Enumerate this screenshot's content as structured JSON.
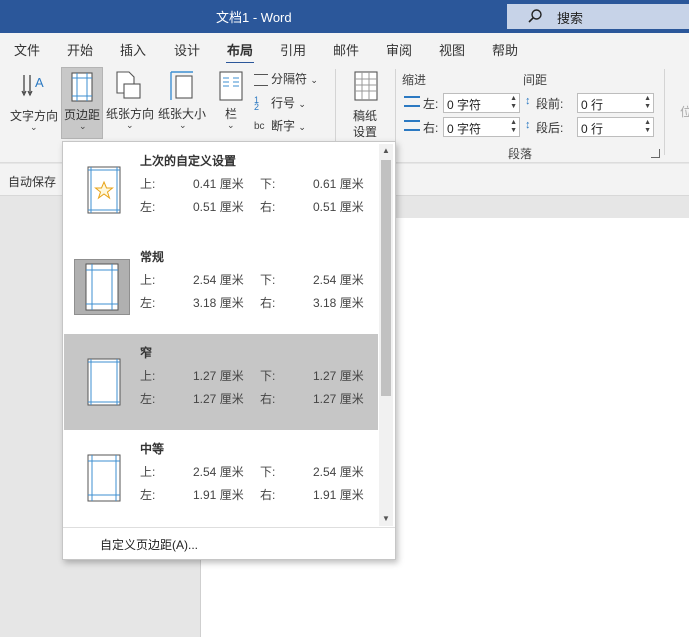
{
  "titlebar": {
    "title": "文档1  -  Word",
    "search_label": "搜索"
  },
  "tabs": [
    {
      "label": "文件"
    },
    {
      "label": "开始"
    },
    {
      "label": "插入"
    },
    {
      "label": "设计"
    },
    {
      "label": "布局"
    },
    {
      "label": "引用"
    },
    {
      "label": "邮件"
    },
    {
      "label": "审阅"
    },
    {
      "label": "视图"
    },
    {
      "label": "帮助"
    }
  ],
  "ribbon": {
    "text_direction": "文字方向",
    "margins": "页边距",
    "orientation": "纸张方向",
    "size": "纸张大小",
    "columns": "栏",
    "breaks": "分隔符",
    "line_numbers": "行号",
    "hyphenation": "断字",
    "manuscript_line1": "稿纸",
    "manuscript_line2": "设置",
    "indent_title": "缩进",
    "spacing_title": "间距",
    "indent_left_label": "左:",
    "indent_left_value": "0 字符",
    "indent_right_label": "右:",
    "indent_right_value": "0 字符",
    "space_before_label": "段前:",
    "space_before_value": "0 行",
    "space_after_label": "段后:",
    "space_after_value": "0 行",
    "paragraph_group": "段落",
    "position_partial": "位"
  },
  "quickbar": {
    "autosave": "自动保存"
  },
  "margins_menu": {
    "items": [
      {
        "name": "上次的自定义设置",
        "top_label": "上:",
        "top": "0.41 厘米",
        "bottom_label": "下:",
        "bottom": "0.61 厘米",
        "left_label": "左:",
        "left": "0.51 厘米",
        "right_label": "右:",
        "right": "0.51 厘米"
      },
      {
        "name": "常规",
        "top_label": "上:",
        "top": "2.54 厘米",
        "bottom_label": "下:",
        "bottom": "2.54 厘米",
        "left_label": "左:",
        "left": "3.18 厘米",
        "right_label": "右:",
        "right": "3.18 厘米"
      },
      {
        "name": "窄",
        "top_label": "上:",
        "top": "1.27 厘米",
        "bottom_label": "下:",
        "bottom": "1.27 厘米",
        "left_label": "左:",
        "left": "1.27 厘米",
        "right_label": "右:",
        "right": "1.27 厘米"
      },
      {
        "name": "中等",
        "top_label": "上:",
        "top": "2.54 厘米",
        "bottom_label": "下:",
        "bottom": "2.54 厘米",
        "left_label": "左:",
        "left": "1.91 厘米",
        "right_label": "右:",
        "right": "1.91 厘米"
      }
    ],
    "selected_item": "窄",
    "custom_label": "自定义页边距(A)..."
  },
  "colors": {
    "accent": "#2b579a",
    "thumb_line": "#3d8fd1",
    "star": "#e8a317"
  }
}
